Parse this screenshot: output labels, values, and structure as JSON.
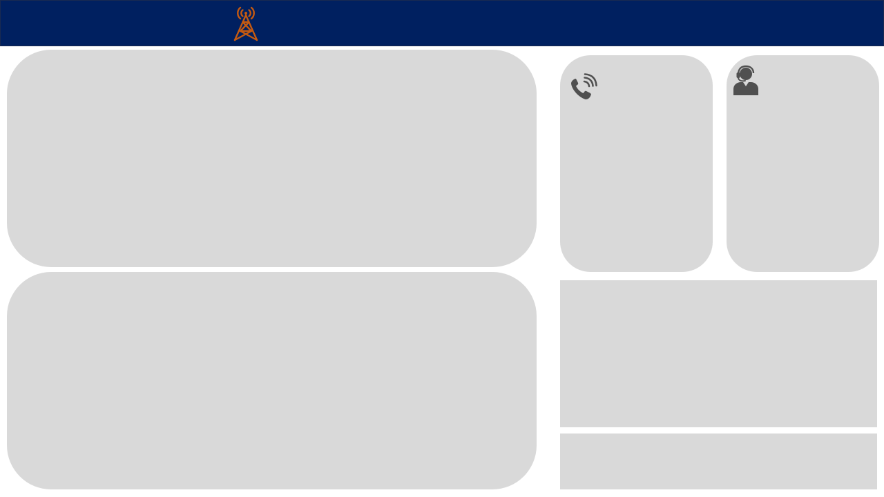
{
  "header": {
    "logo_icon": "cell-tower-icon",
    "background_color": "#002060",
    "accent_color": "#c55a11"
  },
  "panels": {
    "calls_card": {
      "icon": "phone-ringing-icon"
    },
    "agents_card": {
      "icon": "headset-agent-icon"
    },
    "panel_color": "#d9d9d9",
    "icon_color": "#505050"
  }
}
